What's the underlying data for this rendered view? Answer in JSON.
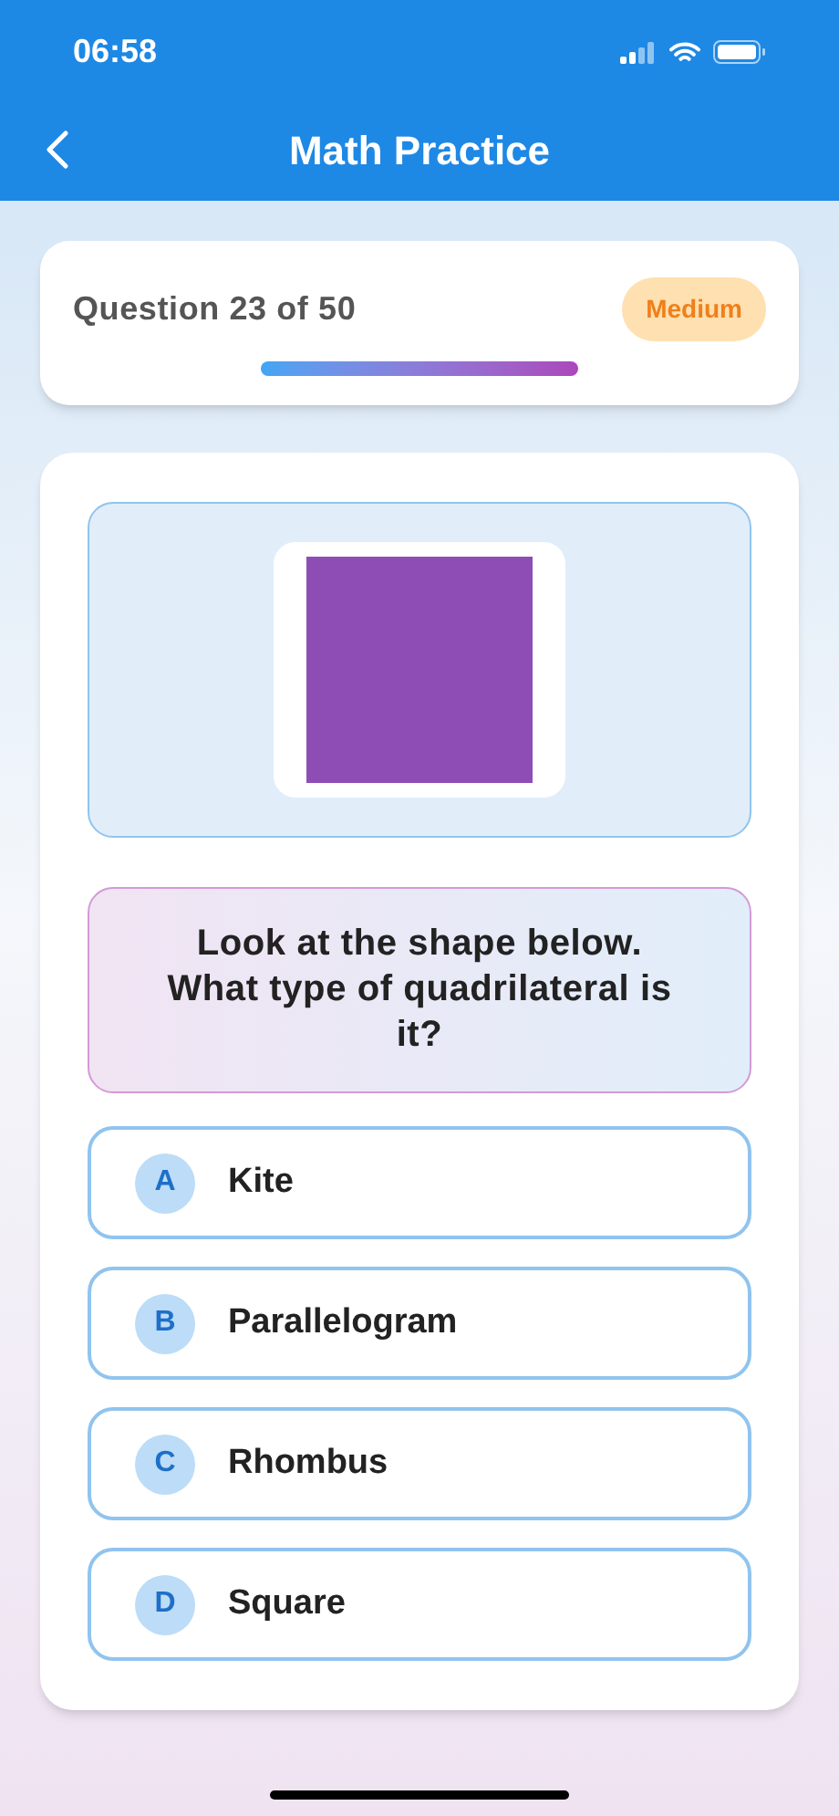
{
  "status_bar": {
    "time": "06:58"
  },
  "header": {
    "title": "Math Practice"
  },
  "progress": {
    "label": "Question 23 of 50",
    "difficulty": "Medium",
    "level": 0.46
  },
  "question": {
    "figure": {
      "kind": "square",
      "color": "#8e4db5"
    },
    "text": "Look at the shape below. What type of quadrilateral is it?"
  },
  "options": [
    {
      "letter": "A",
      "text": "Kite"
    },
    {
      "letter": "B",
      "text": "Parallelogram"
    },
    {
      "letter": "C",
      "text": "Rhombus"
    },
    {
      "letter": "D",
      "text": "Square"
    }
  ]
}
